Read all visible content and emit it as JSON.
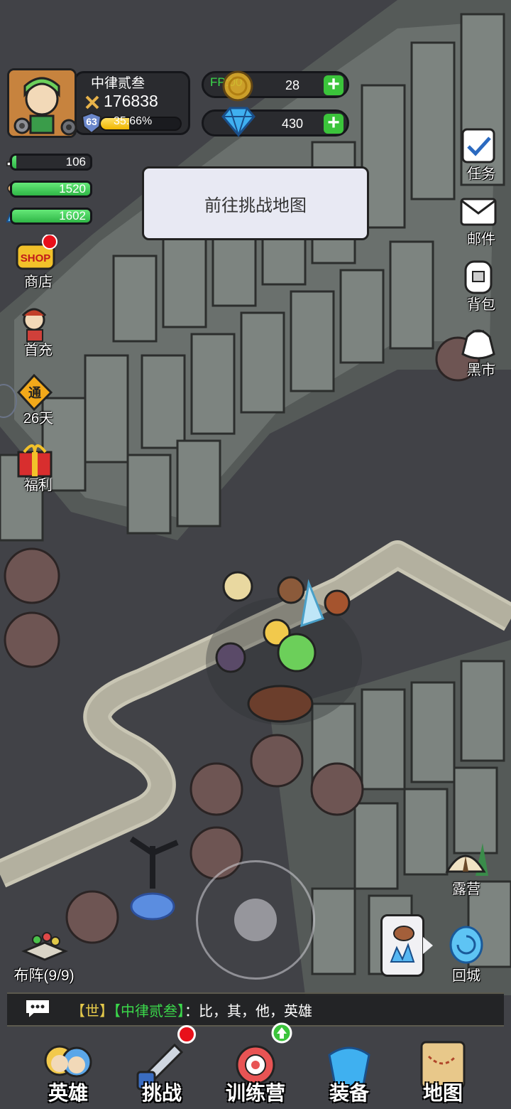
{
  "player": {
    "name": "中律贰叁",
    "power": "176838",
    "level": "63",
    "xp_percent_text": "35.66%",
    "xp_fraction": 0.3566
  },
  "currency": {
    "fp_label": "FP:00",
    "gold_value": "28",
    "diamond_value": "430"
  },
  "resources": [
    {
      "icon": "meat-icon",
      "value": "106",
      "fill": 0.05
    },
    {
      "icon": "wood-icon",
      "value": "1520",
      "fill": 1.0
    },
    {
      "icon": "crystal-icon",
      "value": "1602",
      "fill": 1.0
    }
  ],
  "notice": "前往挑战地图",
  "left_menu": [
    {
      "icon": "shop-icon",
      "label": "商店"
    },
    {
      "icon": "first-charge-icon",
      "label": "首充"
    },
    {
      "icon": "pass-icon",
      "label": "26天"
    },
    {
      "icon": "gift-icon",
      "label": "福利"
    }
  ],
  "right_menu": [
    {
      "icon": "task-icon",
      "label": "任务"
    },
    {
      "icon": "mail-icon",
      "label": "邮件"
    },
    {
      "icon": "backpack-icon",
      "label": "背包"
    },
    {
      "icon": "black-market-icon",
      "label": "黑市"
    }
  ],
  "camp_label": "露营",
  "return_label": "回城",
  "formation_label": "布阵(9/9)",
  "chat": {
    "channel": "【世】",
    "sender": "【中律贰叁】",
    "separator": "：",
    "message": "比，其，他，英雄"
  },
  "nav": [
    {
      "label": "英雄",
      "icon": "heroes-icon"
    },
    {
      "label": "挑战",
      "icon": "sword-shield-icon"
    },
    {
      "label": "训练营",
      "icon": "target-icon"
    },
    {
      "label": "装备",
      "icon": "armor-icon"
    },
    {
      "label": "地图",
      "icon": "scroll-map-icon"
    }
  ],
  "colors": {
    "accent_green": "#3bc43b",
    "chat_world": "#e3c84a",
    "chat_name": "#3bd94b",
    "badge_red": "#e8101a"
  }
}
